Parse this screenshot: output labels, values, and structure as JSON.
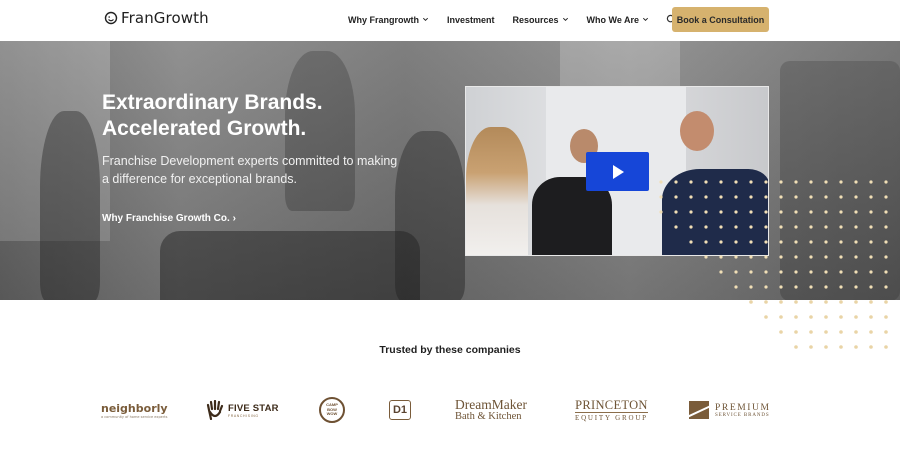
{
  "header": {
    "logo_text": "FranGrowth",
    "nav": [
      {
        "label": "Why Frangrowth",
        "has_dropdown": true
      },
      {
        "label": "Investment",
        "has_dropdown": false
      },
      {
        "label": "Resources",
        "has_dropdown": true
      },
      {
        "label": "Who We Are",
        "has_dropdown": true
      }
    ],
    "search_icon": "search-icon",
    "cta_label": "Book a Consultation"
  },
  "hero": {
    "title_line1": "Extraordinary Brands.",
    "title_line2": "Accelerated Growth.",
    "subtitle": "Franchise Development experts committed to making a difference for exceptional brands.",
    "link_label": "Why Franchise Growth Co. ›",
    "video_icon": "play-icon"
  },
  "trusted": {
    "heading": "Trusted by these companies",
    "brands": {
      "neighborly": {
        "name": "neighborly",
        "tagline": "a community of home service experts"
      },
      "fivestar": {
        "name": "FIVE STAR",
        "tagline": "FRANCHISING"
      },
      "camp": {
        "line1": "CAMP",
        "line2": "BOW",
        "line3": "WOW"
      },
      "d1": {
        "name": "D1"
      },
      "dreammaker": {
        "line1": "DreamMaker",
        "line2": "Bath & Kitchen"
      },
      "princeton": {
        "line1": "PRINCETON",
        "line2": "EQUITY GROUP"
      },
      "premium": {
        "line1": "PREMIUM",
        "line2": "SERVICE BRANDS"
      }
    }
  },
  "colors": {
    "accent_gold": "#d6b26e",
    "video_play_blue": "#1646d8",
    "brand_brown": "#7a5c3a"
  }
}
